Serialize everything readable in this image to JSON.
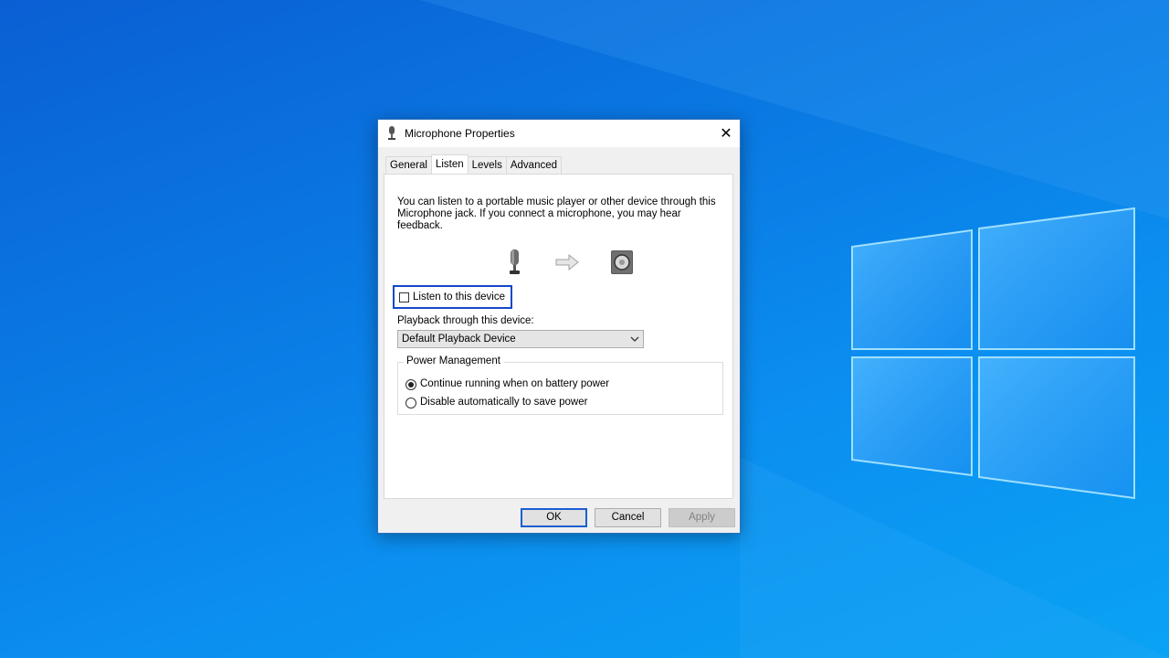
{
  "dialog": {
    "title": "Microphone Properties",
    "close_glyph": "✕"
  },
  "tabs": [
    {
      "label": "General",
      "active": false
    },
    {
      "label": "Listen",
      "active": true
    },
    {
      "label": "Levels",
      "active": false
    },
    {
      "label": "Advanced",
      "active": false
    }
  ],
  "listen": {
    "description": "You can listen to a portable music player or other device through this Microphone jack.  If you connect a microphone, you may hear feedback.",
    "icons": [
      "microphone-icon",
      "arrow-right-icon",
      "speaker-icon"
    ],
    "checkbox_label": "Listen to this device",
    "checkbox_checked": false,
    "playback_label": "Playback through this device:",
    "playback_selected": "Default Playback Device"
  },
  "power": {
    "title": "Power Management",
    "options": [
      {
        "label": "Continue running when on battery power",
        "checked": true
      },
      {
        "label": "Disable automatically to save power",
        "checked": false
      }
    ]
  },
  "buttons": {
    "ok": "OK",
    "cancel": "Cancel",
    "apply": "Apply"
  },
  "colors": {
    "focus_outline": "#1447c9",
    "desktop_blue": "#0a78e2"
  }
}
